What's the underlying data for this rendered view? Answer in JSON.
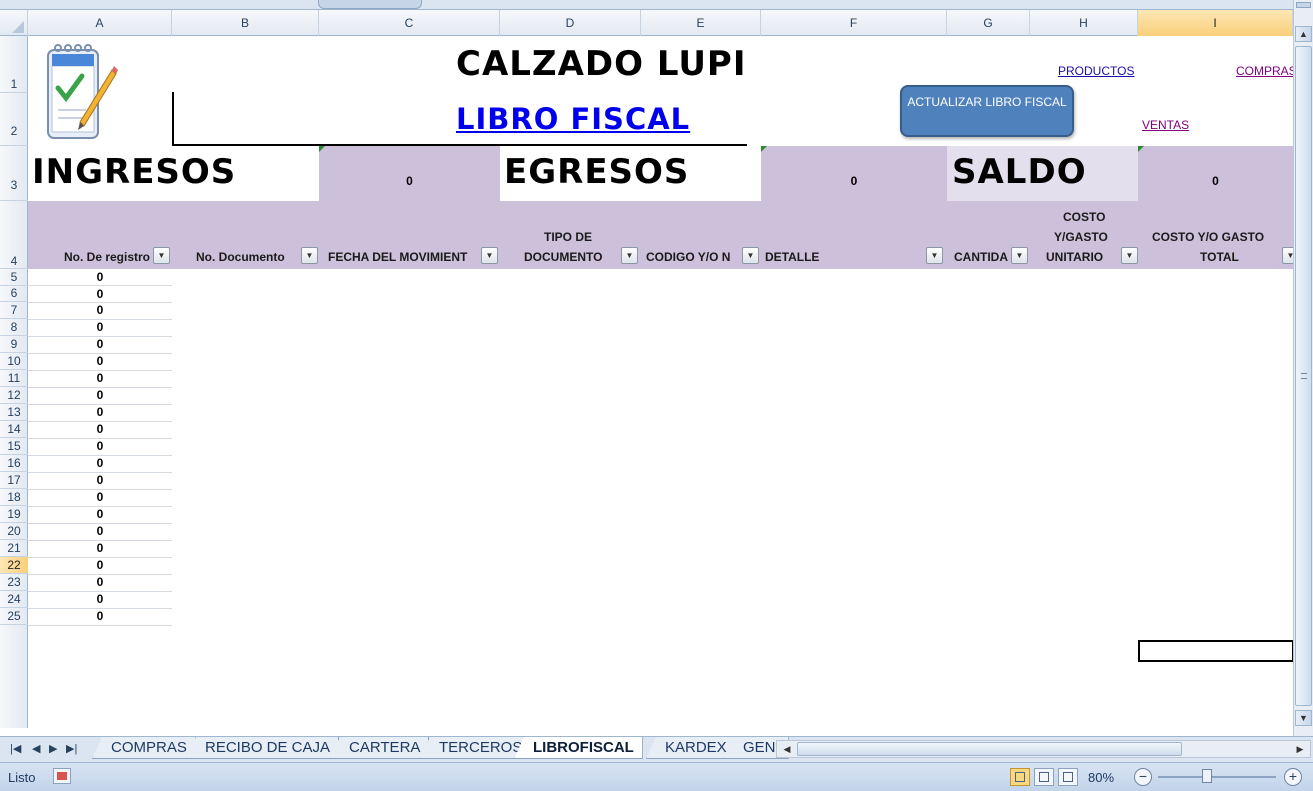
{
  "columns": [
    "A",
    "B",
    "C",
    "D",
    "E",
    "F",
    "G",
    "H",
    "I"
  ],
  "rows": [
    "1",
    "2",
    "3",
    "4",
    "5",
    "6",
    "7",
    "8",
    "9",
    "10",
    "11",
    "12",
    "13",
    "14",
    "15",
    "16",
    "17",
    "18",
    "19",
    "20",
    "21",
    "22",
    "23",
    "24",
    "25"
  ],
  "selected_row": "22",
  "selected_column": "I",
  "sheet": {
    "company": "CALZADO LUPI",
    "subtitle": "LIBRO FISCAL",
    "links": {
      "productos": "PRODUCTOS",
      "compras": "COMPRAS",
      "ventas": "VENTAS"
    },
    "button_label": "ACTUALIZAR LIBRO FISCAL",
    "ingresos_label": "INGRESOS",
    "ingresos_value": "0",
    "egresos_label": "EGRESOS",
    "egresos_value": "0",
    "saldo_label": "SALDO",
    "saldo_value": "0",
    "headers": {
      "registro": "No. De registro",
      "documento": "No. Documento",
      "fecha": "FECHA DEL MOVIMIENT",
      "tipo_line1": "TIPO DE",
      "tipo_line2": "DOCUMENTO",
      "codigo": "CODIGO Y/O N",
      "detalle": "DETALLE",
      "cantidad": "CANTIDA",
      "costo_unit_line1": "COSTO",
      "costo_unit_line2": "Y/GASTO",
      "costo_unit_line3": "UNITARIO",
      "costo_total_line1": "COSTO Y/O GASTO",
      "costo_total_line2": "TOTAL"
    },
    "registro_values": [
      "0",
      "0",
      "0",
      "0",
      "0",
      "0",
      "0",
      "0",
      "0",
      "0",
      "0",
      "0",
      "0",
      "0",
      "0",
      "0",
      "0",
      "0",
      "0",
      "0",
      "0"
    ]
  },
  "tabs": [
    "COMPRAS",
    "RECIBO DE CAJA",
    "CARTERA",
    "TERCEROS",
    "LIBROFISCAL",
    "KARDEX",
    "GENI"
  ],
  "active_tab": "LIBROFISCAL",
  "status": {
    "text": "Listo",
    "zoom": "80%"
  },
  "colors": {
    "band": "#ccc0da",
    "button": "#4f81bd",
    "link": "#1a0dab",
    "visited_link": "#800080"
  }
}
